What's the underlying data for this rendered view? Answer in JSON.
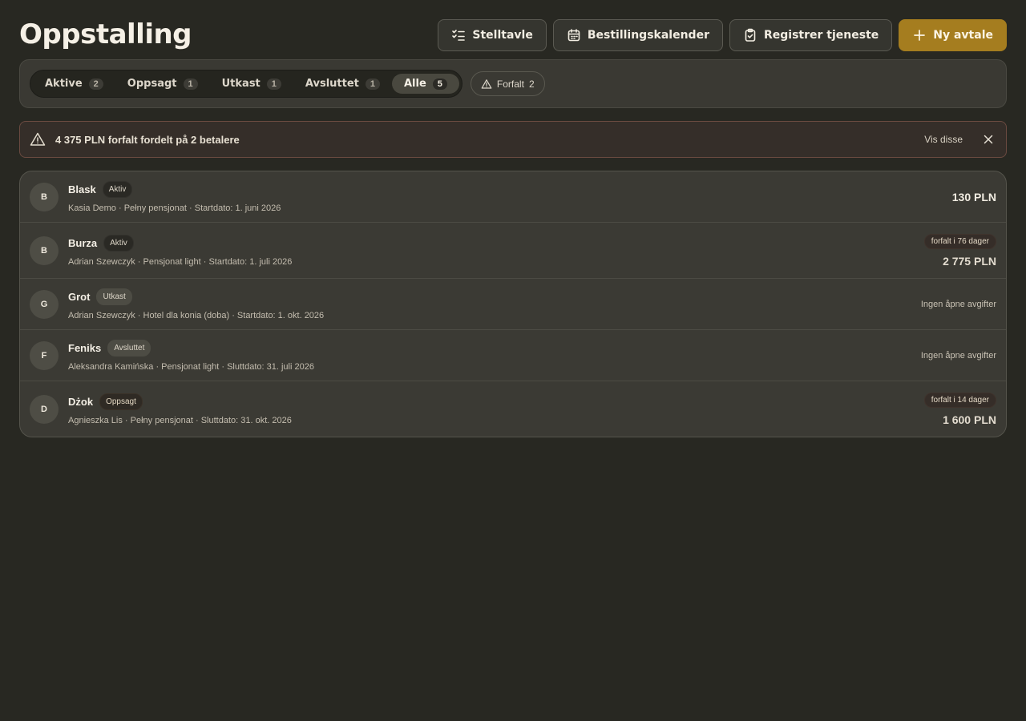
{
  "title": "Oppstalling",
  "actions": {
    "care_board": "Stelltavle",
    "booking_calendar": "Bestillingskalender",
    "register_service": "Registrer tjeneste",
    "new_agreement": "Ny avtale"
  },
  "filters": {
    "tabs": [
      {
        "label": "Aktive",
        "count": "2"
      },
      {
        "label": "Oppsagt",
        "count": "1"
      },
      {
        "label": "Utkast",
        "count": "1"
      },
      {
        "label": "Avsluttet",
        "count": "1"
      },
      {
        "label": "Alle",
        "count": "5"
      }
    ],
    "active_tab": "Alle",
    "overdue": {
      "label": "Forfalt",
      "count": "2"
    }
  },
  "alert": {
    "text": "4 375 PLN forfalt fordelt på 2 betalere",
    "link": "Vis disse"
  },
  "agreements": [
    {
      "initial": "B",
      "name": "Blask",
      "status": "Aktiv",
      "meta": "Kasia Demo · Pełny pensjonat · Startdato: 1. juni 2026",
      "amount": "130 PLN"
    },
    {
      "initial": "B",
      "name": "Burza",
      "status": "Aktiv",
      "meta": "Adrian Szewczyk · Pensjonat light · Startdato: 1. juli 2026",
      "due": "forfalt i 76 dager",
      "amount": "2 775 PLN"
    },
    {
      "initial": "G",
      "name": "Grot",
      "status": "Utkast",
      "meta": "Adrian Szewczyk · Hotel dla konia (doba) · Startdato: 1. okt. 2026",
      "no_fees": "Ingen åpne avgifter"
    },
    {
      "initial": "F",
      "name": "Feniks",
      "status": "Avsluttet",
      "meta": "Aleksandra Kamińska · Pensjonat light · Sluttdato: 31. juli 2026",
      "no_fees": "Ingen åpne avgifter"
    },
    {
      "initial": "D",
      "name": "Dżok",
      "status": "Oppsagt",
      "meta": "Agnieszka Lis · Pełny pensjonat · Sluttdato: 31. okt. 2026",
      "due": "forfalt i 14 dager",
      "amount": "1 600 PLN"
    }
  ],
  "colors": {
    "background": "#282822",
    "panel": "#3b3a34",
    "accent": "#a57d1f",
    "alert_border": "#6a4a40"
  },
  "icons": {
    "care_board": "checklist-icon",
    "booking_calendar": "calendar-icon",
    "register_service": "clipboard-check-icon",
    "new_agreement": "plus-icon",
    "overdue": "warning-triangle-icon",
    "alert": "warning-triangle-icon",
    "alert_close": "close-icon"
  }
}
